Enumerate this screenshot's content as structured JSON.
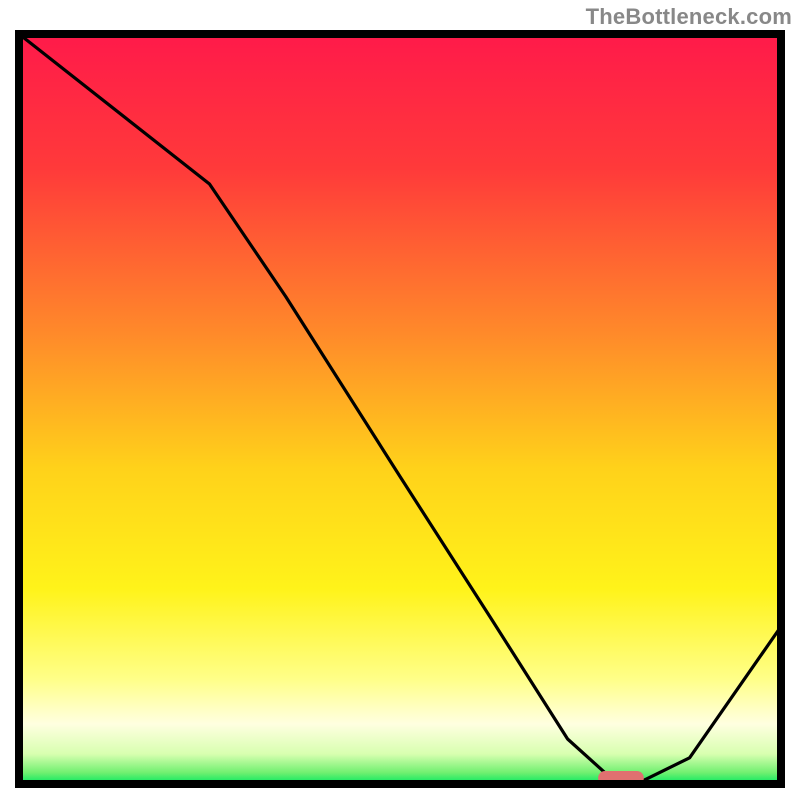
{
  "attribution": {
    "watermark": "TheBottleneck.com"
  },
  "colors": {
    "gradient_stops": [
      {
        "offset": 0.0,
        "color": "#ff1a4a"
      },
      {
        "offset": 0.18,
        "color": "#ff3a3a"
      },
      {
        "offset": 0.4,
        "color": "#ff8a2a"
      },
      {
        "offset": 0.58,
        "color": "#ffd21a"
      },
      {
        "offset": 0.74,
        "color": "#fff31a"
      },
      {
        "offset": 0.86,
        "color": "#ffff88"
      },
      {
        "offset": 0.92,
        "color": "#ffffe0"
      },
      {
        "offset": 0.96,
        "color": "#d8ffb0"
      },
      {
        "offset": 0.985,
        "color": "#70f070"
      },
      {
        "offset": 1.0,
        "color": "#00e860"
      }
    ],
    "curve": "#000000",
    "frame": "#000000",
    "marker": "#e07070"
  },
  "chart_data": {
    "type": "line",
    "title": "",
    "xlabel": "",
    "ylabel": "",
    "xlim": [
      0,
      100
    ],
    "ylim": [
      0,
      100
    ],
    "x": [
      0,
      10,
      25,
      35,
      50,
      62,
      72,
      78,
      82,
      88,
      100
    ],
    "values": [
      100,
      92,
      80,
      65,
      41,
      22,
      6,
      0.5,
      0.5,
      3.5,
      21
    ],
    "marker": {
      "x_from": 76,
      "x_to": 82,
      "y": 0.8
    },
    "notes": "Values estimated from pixel positions; axes have no labels in source image."
  },
  "plot_geometry": {
    "inner_width": 770,
    "inner_height": 758,
    "frame_inset": 4
  }
}
